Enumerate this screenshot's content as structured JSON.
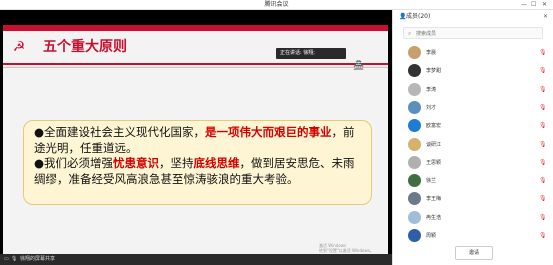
{
  "window": {
    "title": "腾讯会议",
    "min": "—",
    "max": "☐",
    "close": "✕"
  },
  "slide": {
    "title": "五个重大原则",
    "speaking_label": "正在讲话: 徐翔;",
    "para1_lead": "●全面建设社会主义现代化国家，",
    "para1_hl": "是一项伟大而艰巨的事业",
    "para1_tail": "，前途光明，任重道远。",
    "para2_lead": "●我们必须增强",
    "para2_hl1": "忧患意识",
    "para2_mid": "，坚持",
    "para2_hl2": "底线思维",
    "para2_tail": "，做到居安思危、未雨绸缪，准备经受风高浪急甚至惊涛骇浪的重大考验。",
    "watermark_line1": "激活 Windows",
    "watermark_line2": "转到\"设置\"以激活 Windows。"
  },
  "bottombar": {
    "share_label": "徐翔的屏幕共享"
  },
  "panel": {
    "title": "成员(20)",
    "search_placeholder": "搜索成员",
    "invite_label": "邀请",
    "members": [
      {
        "name": "李晨",
        "avatar_color": "#c9a06b"
      },
      {
        "name": "李梦甜",
        "avatar_color": "#333333"
      },
      {
        "name": "李涛",
        "avatar_color": "#b7b7b7"
      },
      {
        "name": "刘才",
        "avatar_color": "#5a8fc0"
      },
      {
        "name": "欧富宏",
        "avatar_color": "#1e7bd6"
      },
      {
        "name": "谈研江",
        "avatar_color": "#d5b16c"
      },
      {
        "name": "王思颖",
        "avatar_color": "#b0b0b0"
      },
      {
        "name": "徐兰",
        "avatar_color": "#3f6e3f"
      },
      {
        "name": "李王梅",
        "avatar_color": "#6a7a8a"
      },
      {
        "name": "冉生浩",
        "avatar_color": "#a0bed8"
      },
      {
        "name": "周颖",
        "avatar_color": "#2c5fa8"
      }
    ]
  }
}
